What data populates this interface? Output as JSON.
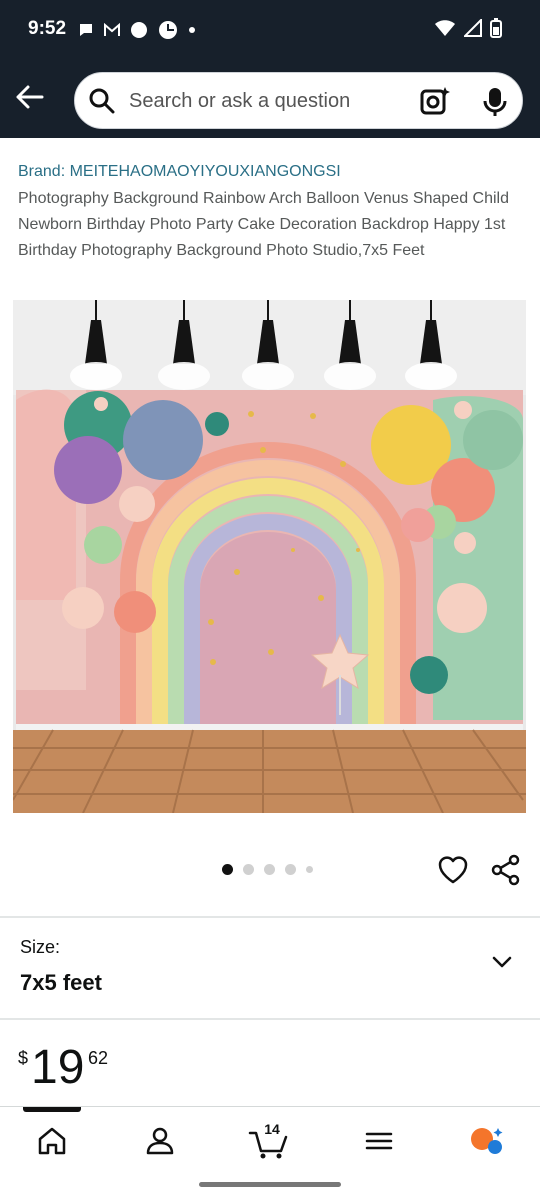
{
  "status_bar": {
    "time": "9:52",
    "left_icons": [
      "chat-icon",
      "gmail-icon",
      "circle-icon",
      "pinwheel-icon",
      "dot-icon"
    ],
    "right_icons": [
      "wifi-icon",
      "signal-icon",
      "battery-icon"
    ]
  },
  "header": {
    "search_placeholder": "Search or ask a question",
    "icons": [
      "back-arrow-icon",
      "search-icon",
      "camera-lens-icon",
      "microphone-icon"
    ]
  },
  "product": {
    "brand": "Brand: MEITEHAOMAOYIYOUXIANGONGSI",
    "title": "Photography Background Rainbow Arch Balloon Venus Shaped Child Newborn Birthday Photo Party Cake Decoration Backdrop Happy 1st Birthday Photography Background Photo Studio,7x5 Feet",
    "image_alt": "Rainbow arch balloon backdrop with pendant lights and wood floor",
    "gallery": {
      "count": 5,
      "active_index": 0
    }
  },
  "size": {
    "label": "Size:",
    "value": "7x5 feet"
  },
  "price": {
    "symbol": "$",
    "whole": "19",
    "fraction": "62"
  },
  "bottom_nav": {
    "cart_count": "14",
    "items": [
      "home-icon",
      "account-icon",
      "cart-icon",
      "menu-icon",
      "rufus-icon"
    ]
  },
  "colors": {
    "header_bg": "#17202b",
    "brand_link": "#2a6f86",
    "title_text": "#565959"
  }
}
